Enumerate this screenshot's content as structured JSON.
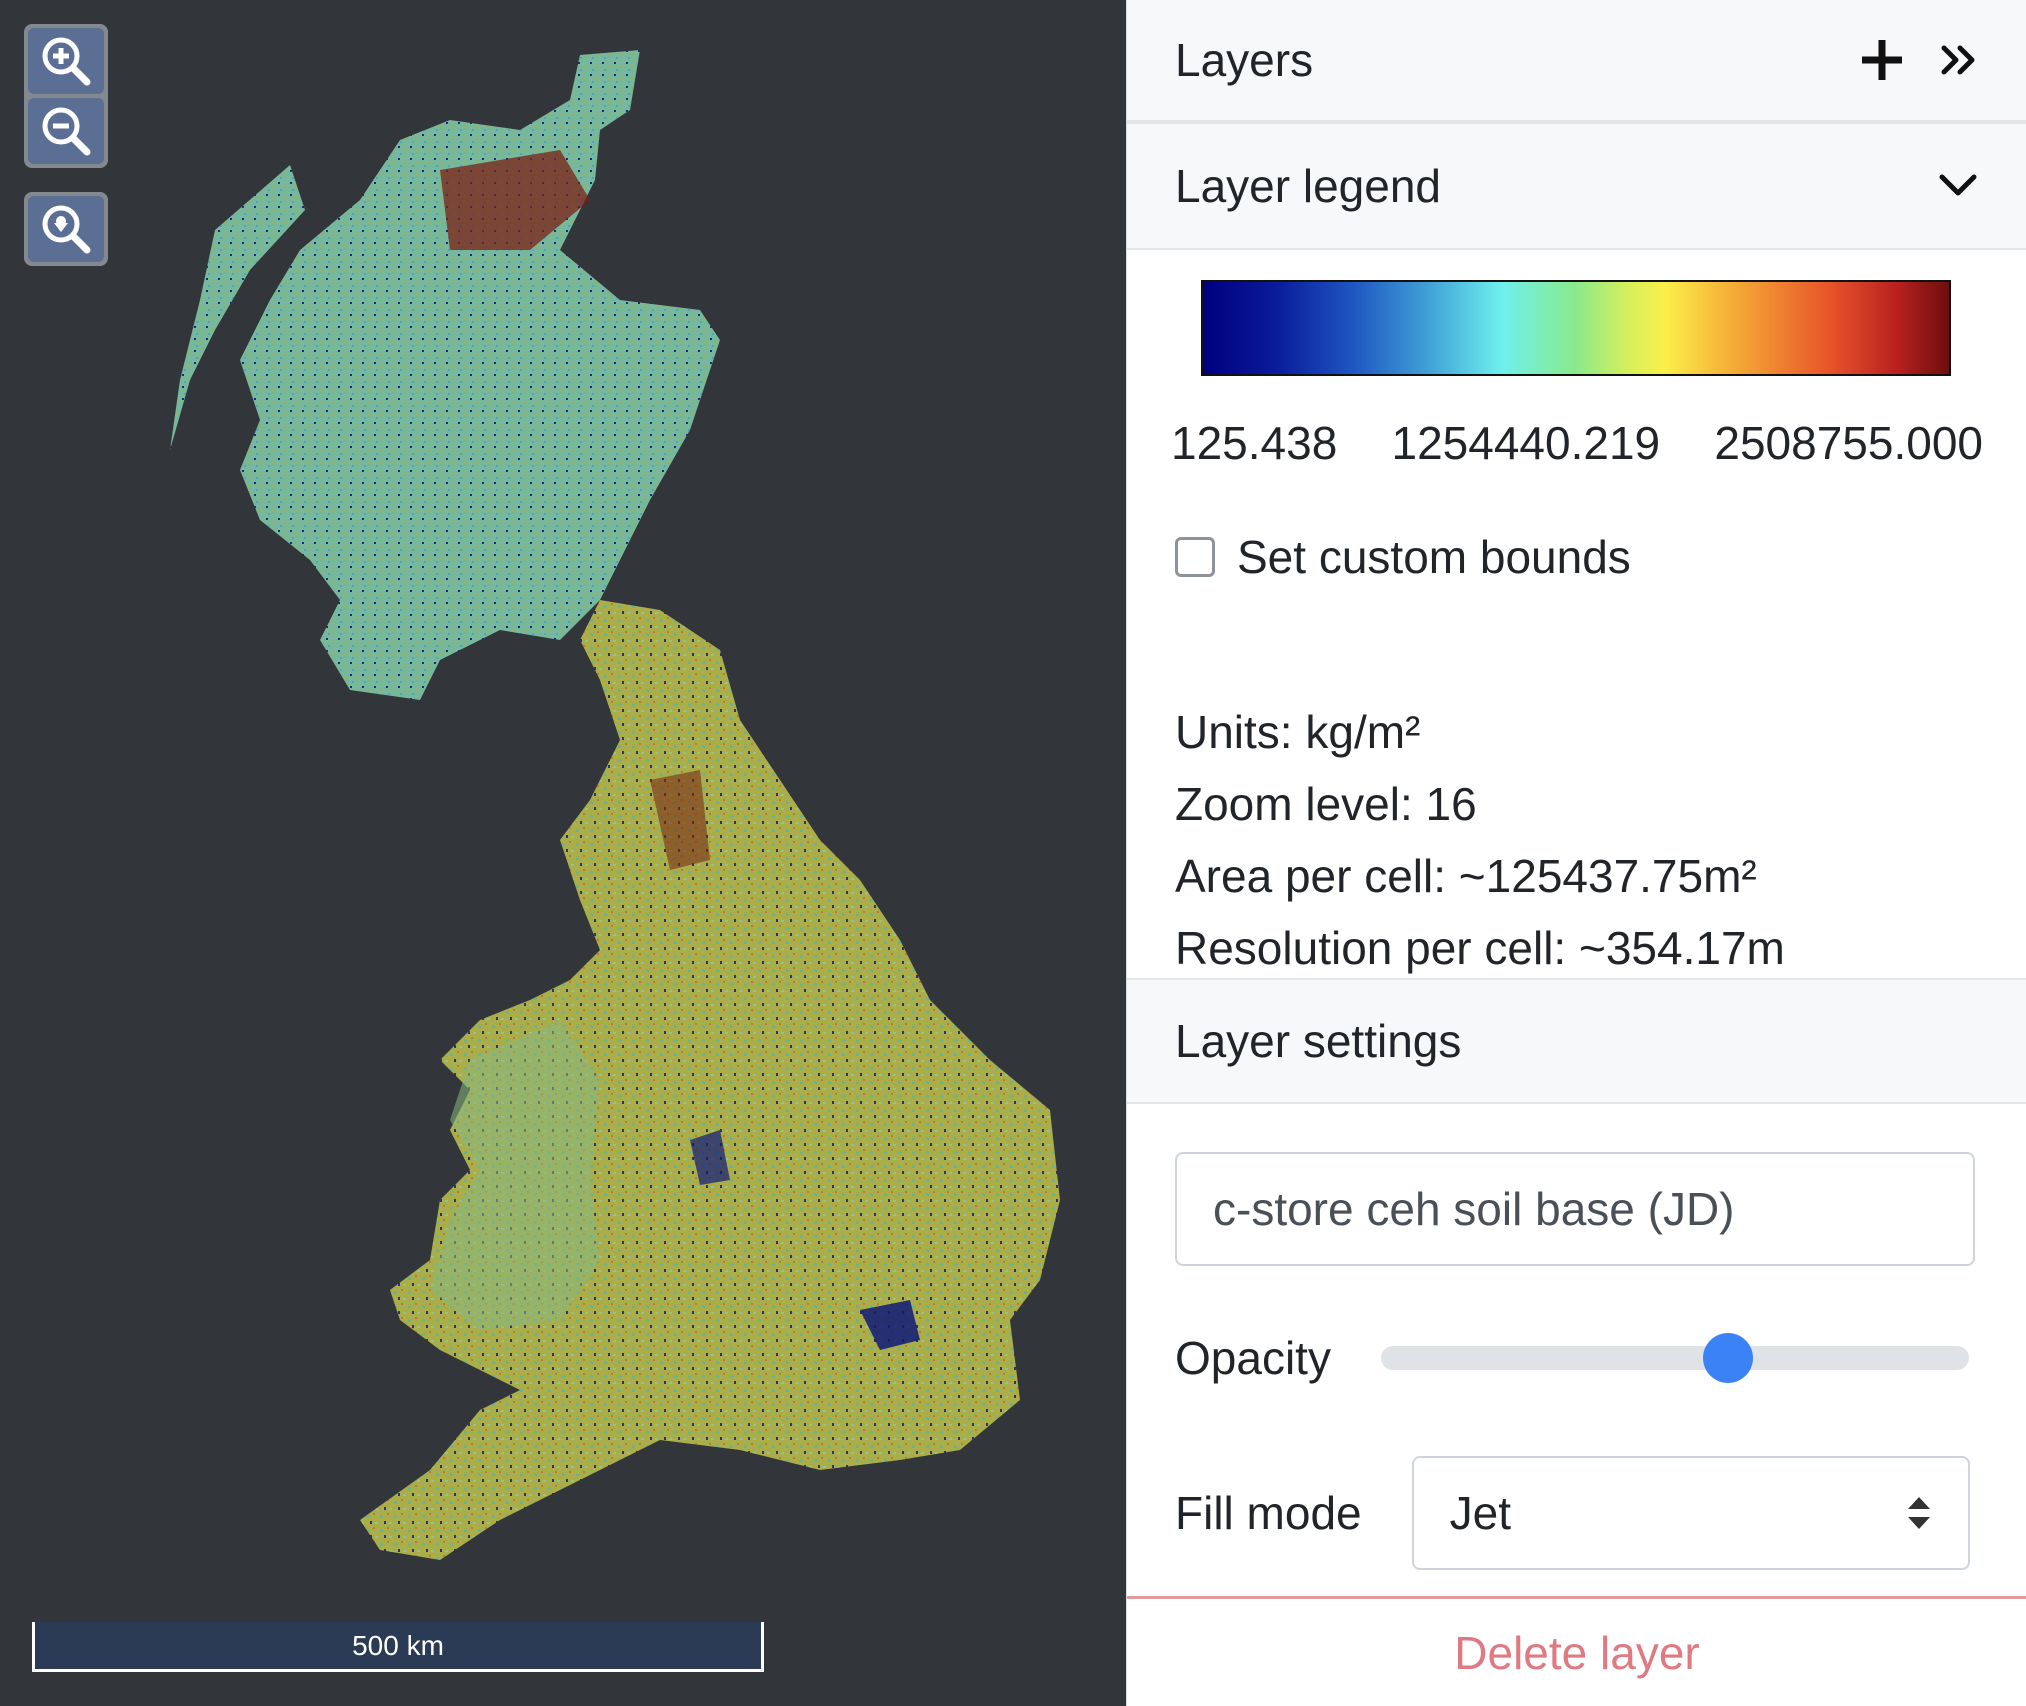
{
  "map": {
    "scale_label": "500 km",
    "zoom_in_icon": "zoom-in-icon",
    "zoom_out_icon": "zoom-out-icon",
    "zoom_extent_icon": "zoom-to-layer-icon"
  },
  "panel": {
    "title": "Layers",
    "add_icon": "plus-icon",
    "collapse_icon": "double-chevron-right-icon"
  },
  "legend": {
    "title": "Layer legend",
    "toggle_icon": "chevron-down-icon",
    "colormap": "Jet",
    "ticks": [
      "125.438",
      "1254440.219",
      "2508755.000"
    ],
    "custom_bounds_label": "Set custom bounds",
    "custom_bounds_checked": false,
    "units": "Units: kg/m²",
    "zoom_level": "Zoom level: 16",
    "area_per_cell": "Area per cell: ~125437.75m²",
    "resolution_per_cell": "Resolution per cell: ~354.17m"
  },
  "settings": {
    "title": "Layer settings",
    "layer_name": "c-store ceh soil base (JD)",
    "opacity_label": "Opacity",
    "opacity_value": 0.59,
    "fill_mode_label": "Fill mode",
    "fill_mode_value": "Jet",
    "delete_label": "Delete layer"
  },
  "colors": {
    "map_background": "#32363b",
    "accent": "#3b82f6",
    "danger": "#e07a82"
  }
}
